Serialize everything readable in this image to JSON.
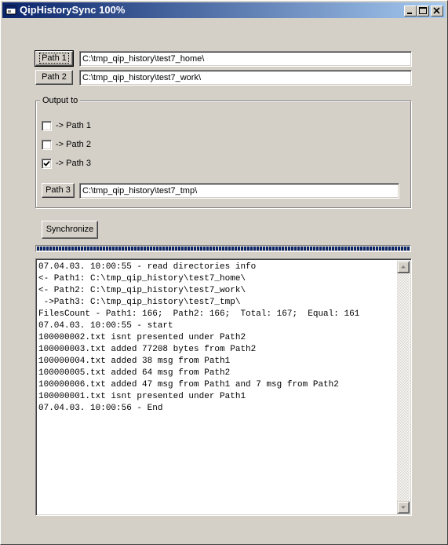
{
  "window": {
    "title": "QipHistorySync 100%",
    "app_icon": "app-window-icon",
    "controls": [
      "minimize-icon",
      "maximize-icon",
      "close-icon"
    ]
  },
  "paths": {
    "path1_button": "Path 1",
    "path1_value": "C:\\tmp_qip_history\\test7_home\\",
    "path2_button": "Path 2",
    "path2_value": "C:\\tmp_qip_history\\test7_work\\"
  },
  "output": {
    "group_label": "Output to",
    "options": [
      {
        "label": "-> Path 1",
        "checked": false
      },
      {
        "label": "-> Path 2",
        "checked": false
      },
      {
        "label": "-> Path 3",
        "checked": true
      }
    ],
    "path3_button": "Path 3",
    "path3_value": "C:\\tmp_qip_history\\test7_tmp\\"
  },
  "actions": {
    "synchronize_label": "Synchronize"
  },
  "progress": {
    "percent": 100
  },
  "log": {
    "lines": [
      "07.04.03. 10:00:55 - read directories info",
      "<- Path1: C:\\tmp_qip_history\\test7_home\\",
      "<- Path2: C:\\tmp_qip_history\\test7_work\\",
      " ->Path3: C:\\tmp_qip_history\\test7_tmp\\",
      "FilesCount - Path1: 166;  Path2: 166;  Total: 167;  Equal: 161",
      "07.04.03. 10:00:55 - start",
      "100000002.txt isnt presented under Path2",
      "100000003.txt added 77208 bytes from Path2",
      "100000004.txt added 38 msg from Path1",
      "100000005.txt added 64 msg from Path2",
      "100000006.txt added 47 msg from Path1 and 7 msg from Path2",
      "100000001.txt isnt presented under Path1",
      "07.04.03. 10:00:56 - End"
    ]
  }
}
